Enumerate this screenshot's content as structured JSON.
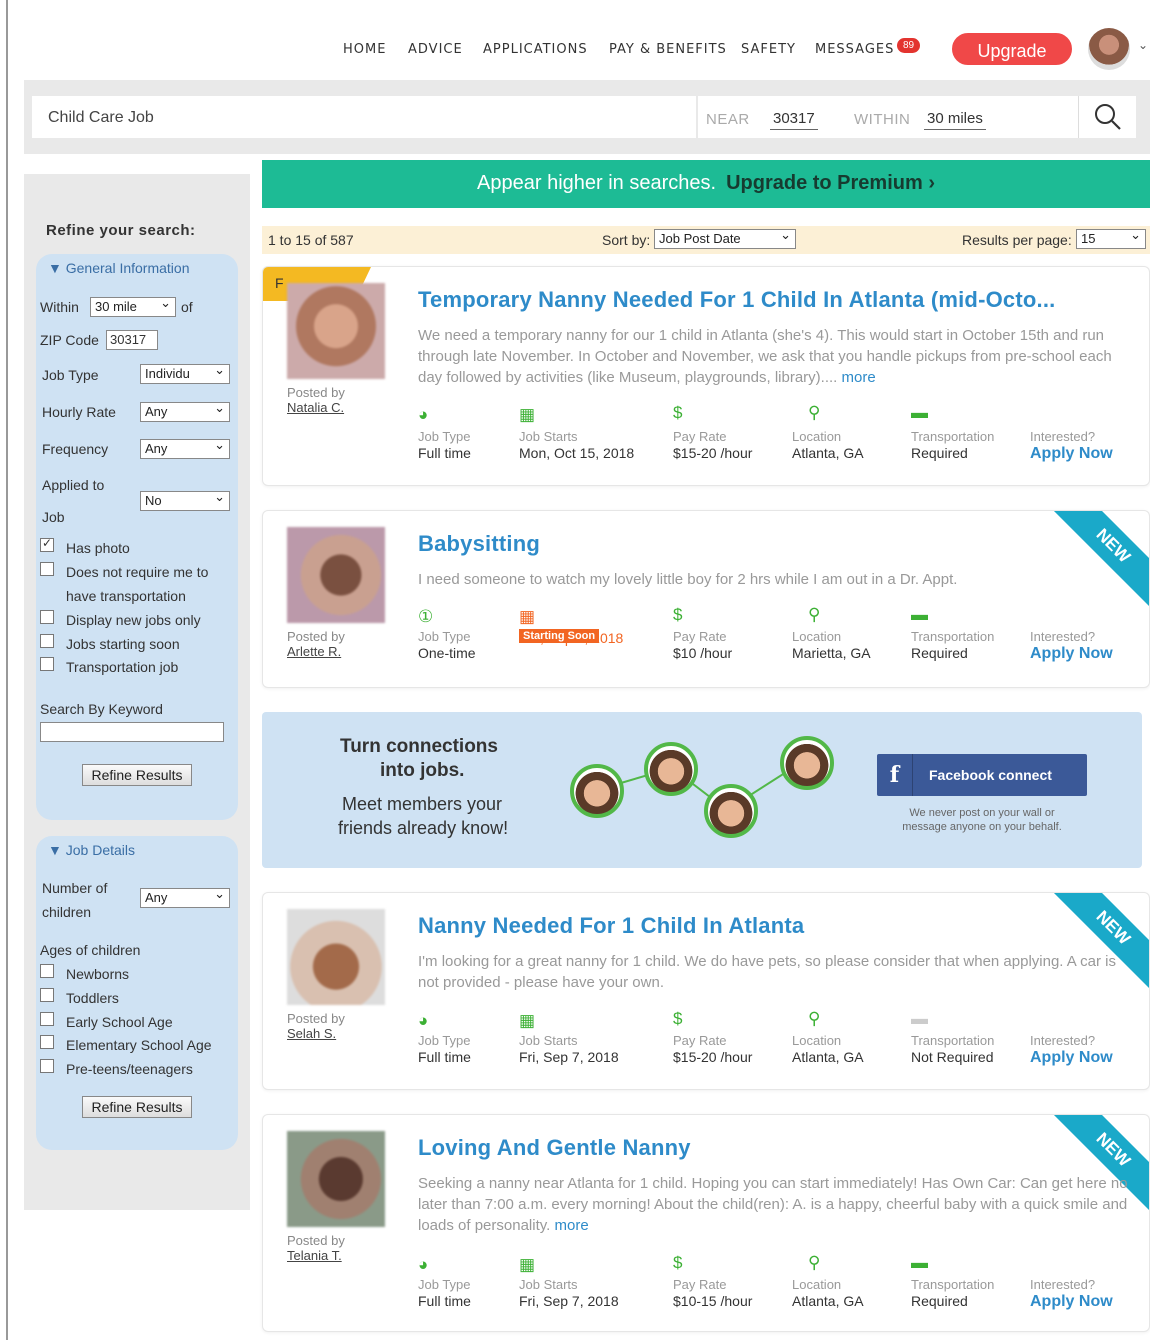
{
  "nav": {
    "items": [
      "HOME",
      "ADVICE",
      "APPLICATIONS",
      "PAY & BENEFITS",
      "SAFETY",
      "MESSAGES"
    ],
    "message_count": "89",
    "upgrade": "Upgrade"
  },
  "search": {
    "query": "Child Care Job",
    "near_label": "NEAR",
    "near_value": "30317",
    "within_label": "WITHIN",
    "within_value": "30 miles"
  },
  "sidebar": {
    "title": "Refine your search:",
    "general": {
      "head": "▼ General Information",
      "within_label": "Within",
      "within_value": "30 mile",
      "of_label": "of",
      "zip_label": "ZIP Code",
      "zip_value": "30317",
      "job_type_label": "Job Type",
      "job_type_value": "Individu",
      "hourly_label": "Hourly Rate",
      "hourly_value": "Any",
      "frequency_label": "Frequency",
      "frequency_value": "Any",
      "applied_label_1": "Applied to",
      "applied_label_2": "Job",
      "applied_value": "No",
      "has_photo": "Has photo",
      "no_transport_1": "Does not require me to",
      "no_transport_2": "have transportation",
      "new_jobs": "Display new jobs only",
      "starting_soon": "Jobs starting soon",
      "transport_job": "Transportation job",
      "keyword_label": "Search By Keyword",
      "refine": "Refine Results"
    },
    "details": {
      "head": "▼ Job Details",
      "num_children_1": "Number of",
      "num_children_2": "children",
      "num_children_value": "Any",
      "ages_label": "Ages of children",
      "ages": [
        "Newborns",
        "Toddlers",
        "Early School Age",
        "Elementary School Age",
        "Pre-teens/teenagers"
      ],
      "refine": "Refine Results"
    }
  },
  "promo": {
    "text": "Appear higher in searches.",
    "cta": "Upgrade to Premium ›"
  },
  "results": {
    "count": "1 to 15 of 587",
    "sort_label": "Sort by:",
    "sort_value": "Job Post Date",
    "per_page_label": "Results per page:",
    "per_page_value": "15"
  },
  "labels": {
    "posted_by": "Posted by",
    "job_type": "Job Type",
    "job_starts": "Job Starts",
    "pay_rate": "Pay Rate",
    "location": "Location",
    "transportation": "Transportation",
    "interested": "Interested?",
    "apply": "Apply Now",
    "new": "NEW",
    "more": "more",
    "starting_soon": "Starting Soon"
  },
  "jobs": [
    {
      "title": "Temporary Nanny Needed For 1 Child In Atlanta (mid-Octo...",
      "poster": "Natalia C.",
      "desc": "We need a temporary nanny for our 1 child in Atlanta (she's 4). This would start in October 15th and run through late November. In October and November, we ask that you handle pickups from pre-school each day followed by activities (like Museum, playgrounds, library)....",
      "job_type": "Full time",
      "starts": "Mon, Oct 15, 2018",
      "pay": "$15-20 /hour",
      "location": "Atlanta, GA",
      "transport": "Required",
      "featured": "F"
    },
    {
      "title": "Babysitting",
      "poster": "Arlette R.",
      "desc": "I need someone to watch my lovely little boy for 2 hrs while I am out in a Dr. Appt.",
      "job_type": "One-time",
      "starts": "Sat, Sep 8, 2018",
      "pay": "$10 /hour",
      "location": "Marietta, GA",
      "transport": "Required"
    },
    {
      "title": "Nanny Needed For 1 Child In Atlanta",
      "poster": "Selah S.",
      "desc": "I'm looking for a great nanny for 1 child. We do have pets, so please consider that when applying. A car is not provided - please have your own.",
      "job_type": "Full time",
      "starts": "Fri, Sep 7, 2018",
      "pay": "$15-20 /hour",
      "location": "Atlanta, GA",
      "transport": "Not Required"
    },
    {
      "title": "Loving And Gentle Nanny",
      "poster": "Telania T.",
      "desc": "Seeking a nanny near Atlanta for 1 child. Hoping you can start immediately! Has Own Car: Can get here no later than 7:00 a.m. every morning! About the child(ren): A. is a happy, cheerful baby with a quick smile and loads of personality.",
      "job_type": "Full time",
      "starts": "Fri, Sep 7, 2018",
      "pay": "$10-15 /hour",
      "location": "Atlanta, GA",
      "transport": "Required"
    }
  ],
  "connect": {
    "title_1": "Turn connections",
    "title_2": "into jobs.",
    "sub_1": "Meet members your",
    "sub_2": "friends already know!",
    "fb": "Facebook connect",
    "note_1": "We never post on your wall or",
    "note_2": "message anyone on your behalf."
  },
  "colors": {
    "accent": "#2e8bc9",
    "promo": "#1dbb95",
    "upgrade": "#f04848",
    "ribbon": "#1aa9c9"
  }
}
